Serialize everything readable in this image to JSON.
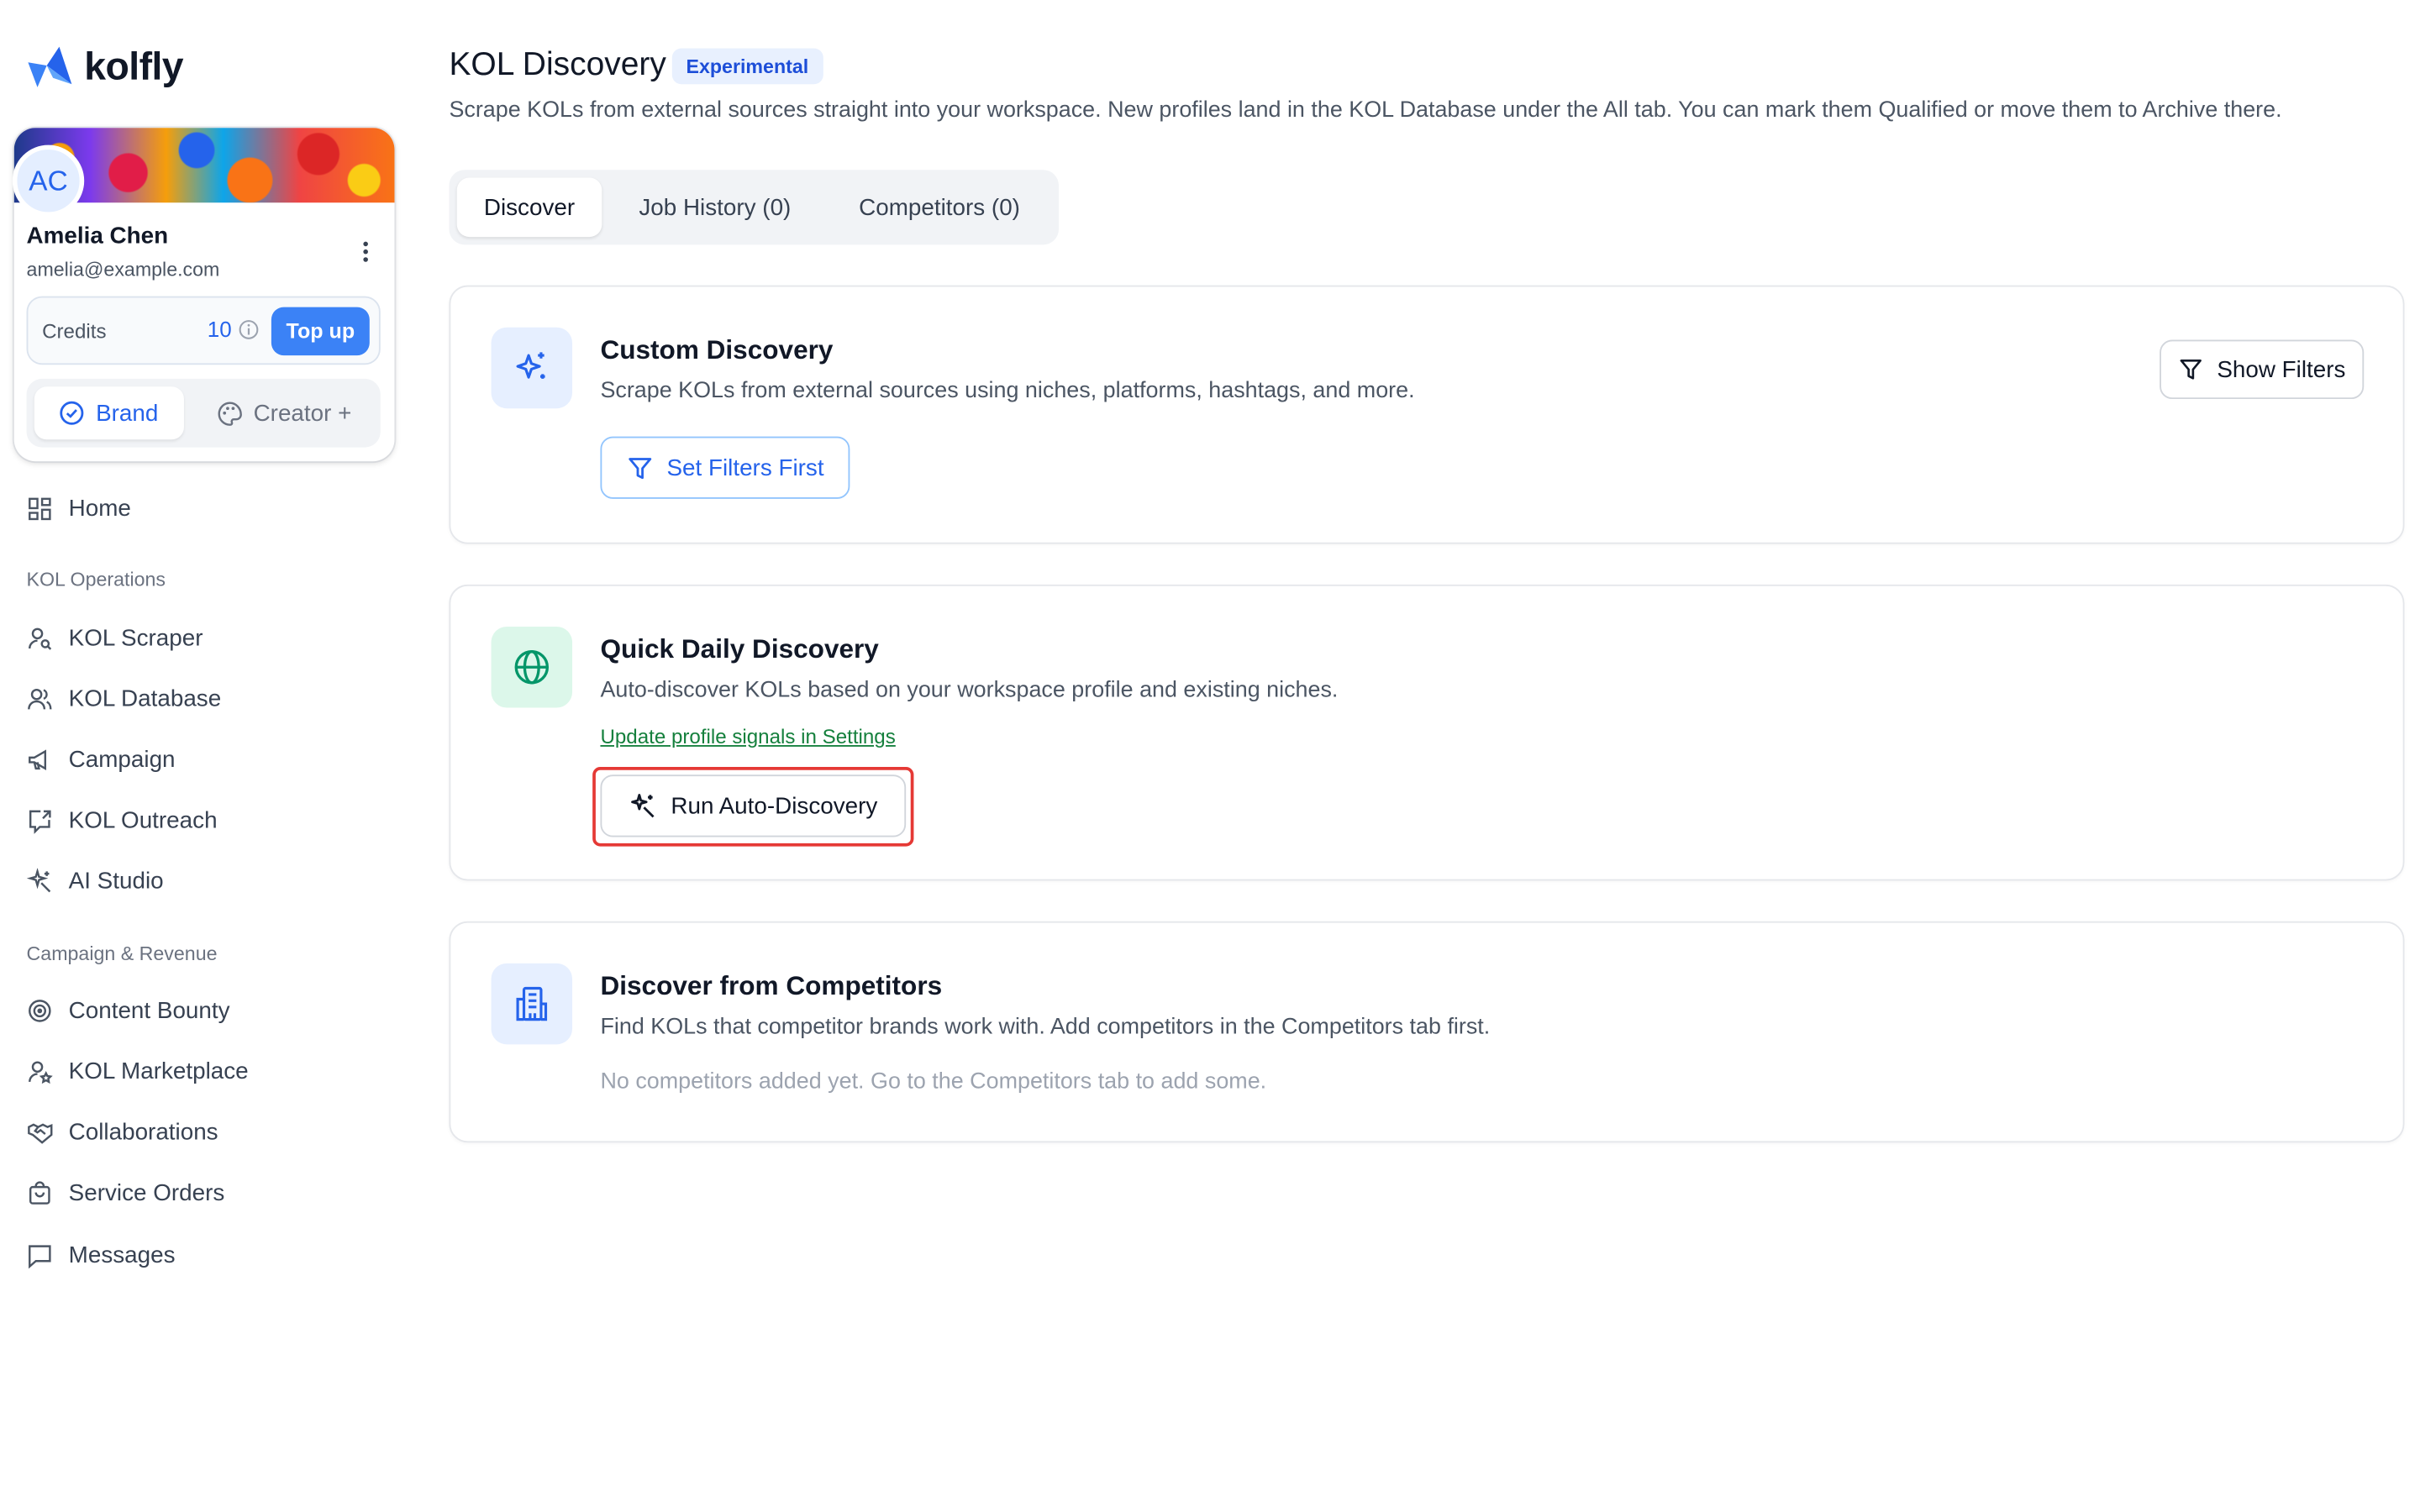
{
  "brand": {
    "logo_text": "kolfly"
  },
  "profile": {
    "initials": "AC",
    "name": "Amelia Chen",
    "email": "amelia@example.com",
    "credits_label": "Credits",
    "credits_value": "10",
    "topup_label": "Top up",
    "mode_brand": "Brand",
    "mode_creator": "Creator +"
  },
  "sidebar": {
    "home": "Home",
    "section1": "KOL Operations",
    "ops": [
      "KOL Scraper",
      "KOL Database",
      "Campaign",
      "KOL Outreach",
      "AI Studio"
    ],
    "section2": "Campaign & Revenue",
    "revenue": [
      "Content Bounty",
      "KOL Marketplace",
      "Collaborations",
      "Service Orders",
      "Messages"
    ]
  },
  "header": {
    "title": "KOL Discovery",
    "badge": "Experimental",
    "description": "Scrape KOLs from external sources straight into your workspace. New profiles land in the KOL Database under the All tab. You can mark them Qualified or move them to Archive there."
  },
  "tabs": [
    "Discover",
    "Job History (0)",
    "Competitors (0)"
  ],
  "custom": {
    "title": "Custom Discovery",
    "desc": "Scrape KOLs from external sources using niches, platforms, hashtags, and more.",
    "set_filters": "Set Filters First",
    "show_filters": "Show Filters"
  },
  "quick": {
    "title": "Quick Daily Discovery",
    "desc": "Auto-discover KOLs based on your workspace profile and existing niches.",
    "link": "Update profile signals in Settings",
    "run": "Run Auto-Discovery"
  },
  "competitors": {
    "title": "Discover from Competitors",
    "desc": "Find KOLs that competitor brands work with. Add competitors in the Competitors tab first.",
    "empty": "No competitors added yet. Go to the Competitors tab to add some."
  },
  "colors": {
    "accent": "#3b82f6",
    "link_green": "#15803d",
    "highlight": "#e53935"
  }
}
